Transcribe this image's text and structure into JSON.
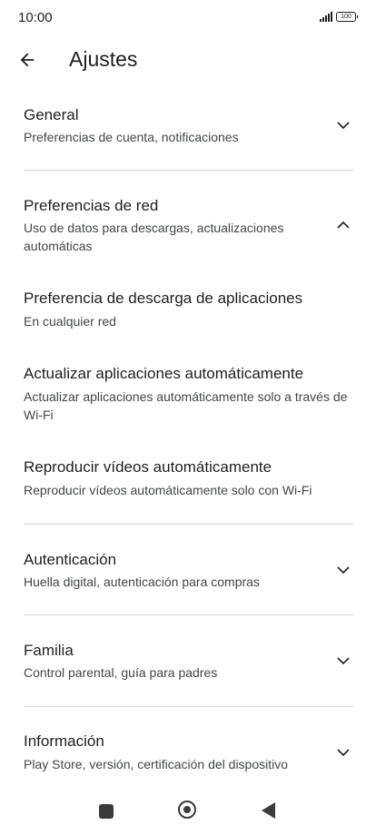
{
  "status_bar": {
    "time": "10:00",
    "battery": "100"
  },
  "app_bar": {
    "title": "Ajustes"
  },
  "sections": {
    "general": {
      "title": "General",
      "subtitle": "Preferencias de cuenta, notificaciones",
      "chevron": "chevron-down"
    },
    "network": {
      "title": "Preferencias de red",
      "subtitle": "Uso de datos para descargas, actualizaciones automáticas",
      "chevron": "chevron-up",
      "items": [
        {
          "title": "Preferencia de descarga de aplicaciones",
          "subtitle": "En cualquier red"
        },
        {
          "title": "Actualizar aplicaciones automáticamente",
          "subtitle": "Actualizar aplicaciones automáticamente solo a través de Wi-Fi"
        },
        {
          "title": "Reproducir vídeos automáticamente",
          "subtitle": "Reproducir vídeos automáticamente solo con Wi-Fi"
        }
      ]
    },
    "auth": {
      "title": "Autenticación",
      "subtitle": "Huella digital, autenticación para compras",
      "chevron": "chevron-down"
    },
    "family": {
      "title": "Familia",
      "subtitle": "Control parental, guía para padres",
      "chevron": "chevron-down"
    },
    "info": {
      "title": "Información",
      "subtitle": "Play Store, versión, certificación del dispositivo",
      "chevron": "chevron-down"
    }
  },
  "nav_bar": {
    "icons": [
      "recents-icon",
      "home-icon",
      "back-icon"
    ]
  }
}
